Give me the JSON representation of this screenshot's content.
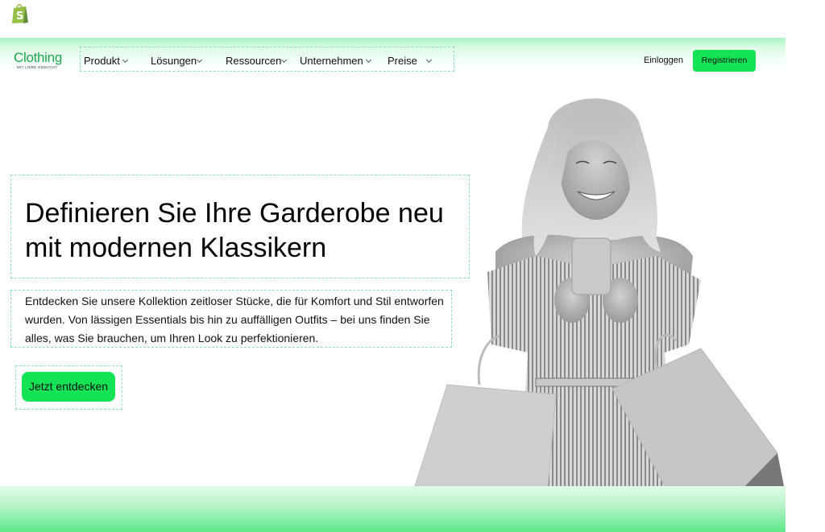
{
  "browser": {
    "favicon": "shopify-bag-icon"
  },
  "brand": {
    "name": "Clothing",
    "tagline": "MIT LIEBE GEMACHT",
    "color": "#19a84a"
  },
  "nav": {
    "items": [
      {
        "label": "Produkt",
        "icon": "chevron-down-icon"
      },
      {
        "label": "Lösungen",
        "icon": "chevron-down-icon"
      },
      {
        "label": "Ressourcen",
        "icon": "chevron-down-icon"
      },
      {
        "label": "Unternehmen",
        "icon": "chevron-down-icon"
      },
      {
        "label": "Preise",
        "icon": "chevron-down-icon"
      }
    ],
    "login_label": "Einloggen",
    "register_label": "Registrieren"
  },
  "hero": {
    "headline": "Definieren Sie Ihre Garderobe neu mit modernen Klassikern",
    "description": "Entdecken Sie unsere Kollektion zeitloser Stücke, die für Komfort und Stil entworfen wurden. Von lässigen Essentials bis hin zu auffälligen Outfits – bei uns finden Sie alles, was Sie brauchen, um Ihren Look zu perfektionieren.",
    "cta_label": "Jetzt entdecken",
    "image_alt": "Lächelnde Frau mit Smartphone und Einkaufstüten"
  },
  "colors": {
    "accent": "#15e356",
    "outline": "#8fe3b0",
    "header_gradient_top": "#a8f3c0",
    "footer_gradient_bottom": "#5ee88a"
  }
}
